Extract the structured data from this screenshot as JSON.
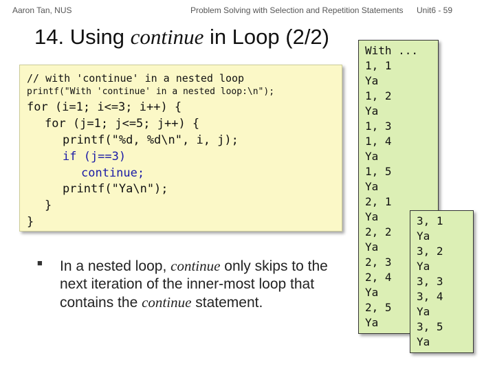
{
  "header": {
    "author": "Aaron Tan, NUS",
    "course": "Problem Solving with Selection and Repetition Statements",
    "unit": "Unit6 - 59"
  },
  "title": {
    "prefix": "14. Using ",
    "keyword": "continue",
    "suffix": " in Loop (2/2)"
  },
  "code": {
    "comment": "// with 'continue' in a nested loop",
    "printf_line": "printf(\"With 'continue' in a nested loop:\\n\");",
    "for_outer": "for (i=1; i<=3; i++) {",
    "for_inner": "for (j=1; j<=5; j++) {",
    "printf_ij": "printf(\"%d, %d\\n\", i, j);",
    "if_line": "if (j==3)",
    "continue_line": "continue;",
    "printf_ya": "printf(\"Ya\\n\");",
    "close_inner": "}",
    "close_outer": "}"
  },
  "bullet": {
    "text_before": "In a nested loop, ",
    "keyword1": "continue",
    "text_middle": " only skips to the next iteration of the inner-most loop that contains the ",
    "keyword2": "continue",
    "text_after": " statement."
  },
  "output_left": [
    "With ...",
    "1, 1",
    "Ya",
    "1, 2",
    "Ya",
    "1, 3",
    "1, 4",
    "Ya",
    "1, 5",
    "Ya",
    "2, 1",
    "Ya",
    "2, 2",
    "Ya",
    "2, 3",
    "2, 4",
    "Ya",
    "2, 5",
    "Ya"
  ],
  "output_right": [
    "3, 1",
    "Ya",
    "3, 2",
    "Ya",
    "3, 3",
    "3, 4",
    "Ya",
    "3, 5",
    "Ya"
  ]
}
